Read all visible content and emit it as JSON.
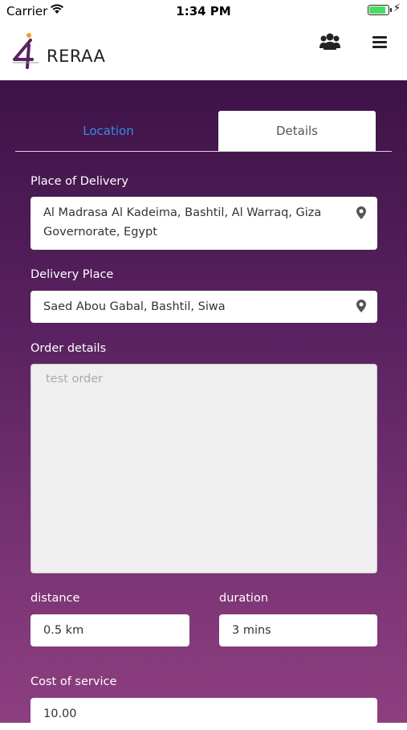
{
  "status_bar": {
    "carrier": "Carrier",
    "time": "1:34 PM"
  },
  "header": {
    "brand": "RERAA",
    "icons": [
      "users-icon",
      "menu-icon"
    ]
  },
  "tabs": [
    {
      "label": "Location",
      "active": true
    },
    {
      "label": "Details",
      "active": false
    }
  ],
  "form": {
    "place_of_delivery": {
      "label": "Place of Delivery",
      "value": "Al Madrasa Al Kadeima, Bashtil, Al Warraq, Giza Governorate, Egypt"
    },
    "delivery_place": {
      "label": "Delivery Place",
      "value": "Saed Abou Gabal, Bashtil, Siwa"
    },
    "order_details": {
      "label": "Order details",
      "placeholder": "test order"
    },
    "distance": {
      "label": "distance",
      "value": "0.5 km"
    },
    "duration": {
      "label": "duration",
      "value": "3 mins"
    },
    "cost": {
      "label": "Cost of service",
      "value": "10.00"
    }
  },
  "colors": {
    "gradient_top": "#3d1347",
    "gradient_bottom": "#8d3f80",
    "active_tab": "#3a8be6",
    "battery": "#4cd964"
  }
}
